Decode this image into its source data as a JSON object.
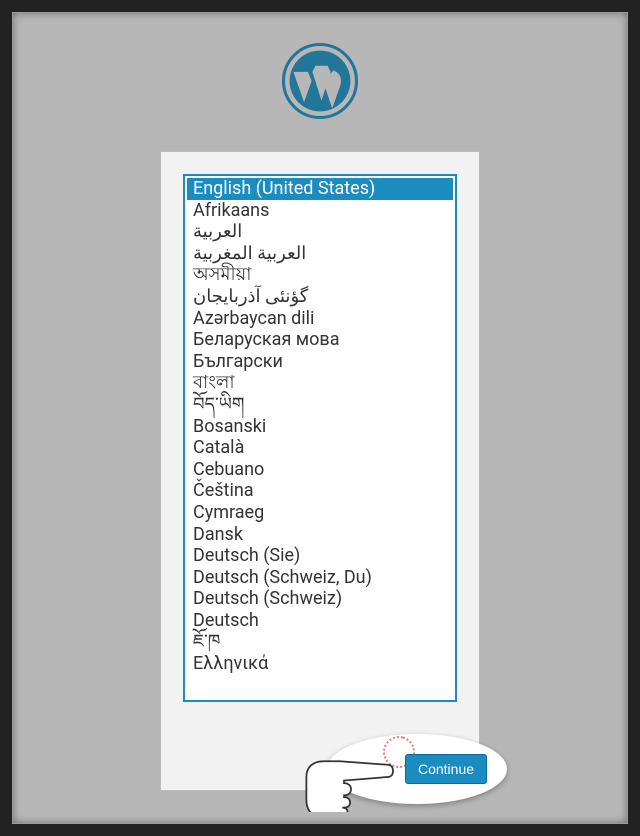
{
  "logo": {
    "name": "wordpress-logo"
  },
  "languages": [
    {
      "label": "English (United States)",
      "selected": true
    },
    {
      "label": "Afrikaans",
      "selected": false
    },
    {
      "label": "العربية",
      "selected": false
    },
    {
      "label": "العربية المغربية",
      "selected": false
    },
    {
      "label": "অসমীয়া",
      "selected": false
    },
    {
      "label": "گؤنئی آذربایجان",
      "selected": false
    },
    {
      "label": "Azərbaycan dili",
      "selected": false
    },
    {
      "label": "Беларуская мова",
      "selected": false
    },
    {
      "label": "Български",
      "selected": false
    },
    {
      "label": "বাংলা",
      "selected": false
    },
    {
      "label": "བོད་ཡིག",
      "selected": false
    },
    {
      "label": "Bosanski",
      "selected": false
    },
    {
      "label": "Català",
      "selected": false
    },
    {
      "label": "Cebuano",
      "selected": false
    },
    {
      "label": "Čeština",
      "selected": false
    },
    {
      "label": "Cymraeg",
      "selected": false
    },
    {
      "label": "Dansk",
      "selected": false
    },
    {
      "label": "Deutsch (Sie)",
      "selected": false
    },
    {
      "label": "Deutsch (Schweiz, Du)",
      "selected": false
    },
    {
      "label": "Deutsch (Schweiz)",
      "selected": false
    },
    {
      "label": "Deutsch",
      "selected": false
    },
    {
      "label": "ཇོ་ཁ",
      "selected": false
    },
    {
      "label": "Ελληνικά",
      "selected": false
    }
  ],
  "continue": {
    "label": "Continue"
  }
}
